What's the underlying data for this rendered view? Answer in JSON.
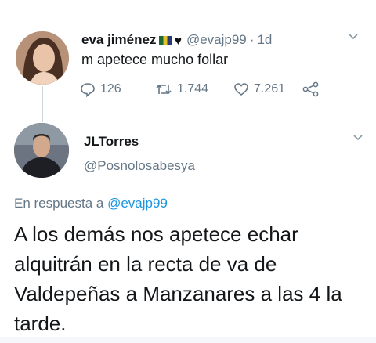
{
  "tweet": {
    "author_name": "eva jiménez",
    "handle": "@evajp99",
    "separator": "·",
    "time": "1d",
    "text": "m apetece mucho follar",
    "stats": {
      "replies": "126",
      "retweets": "1.744",
      "likes": "7.261"
    }
  },
  "reply": {
    "author_name": "JLTorres",
    "handle": "@Posnolosabesya",
    "in_reply_prefix": "En respuesta a",
    "in_reply_handle": "@evajp99",
    "text": "A los demás nos apetece echar alquitrán en la recta de va de Valdepeñas a Manzanares a las 4 la tarde."
  },
  "colors": {
    "text": "#14171a",
    "secondary": "#657786",
    "link": "#1b95e0",
    "divider": "#ccd6dd"
  },
  "icons": [
    "flag-icon",
    "heart-icon",
    "chevron-down-icon",
    "reply-icon",
    "retweet-icon",
    "like-icon",
    "share-icon"
  ]
}
